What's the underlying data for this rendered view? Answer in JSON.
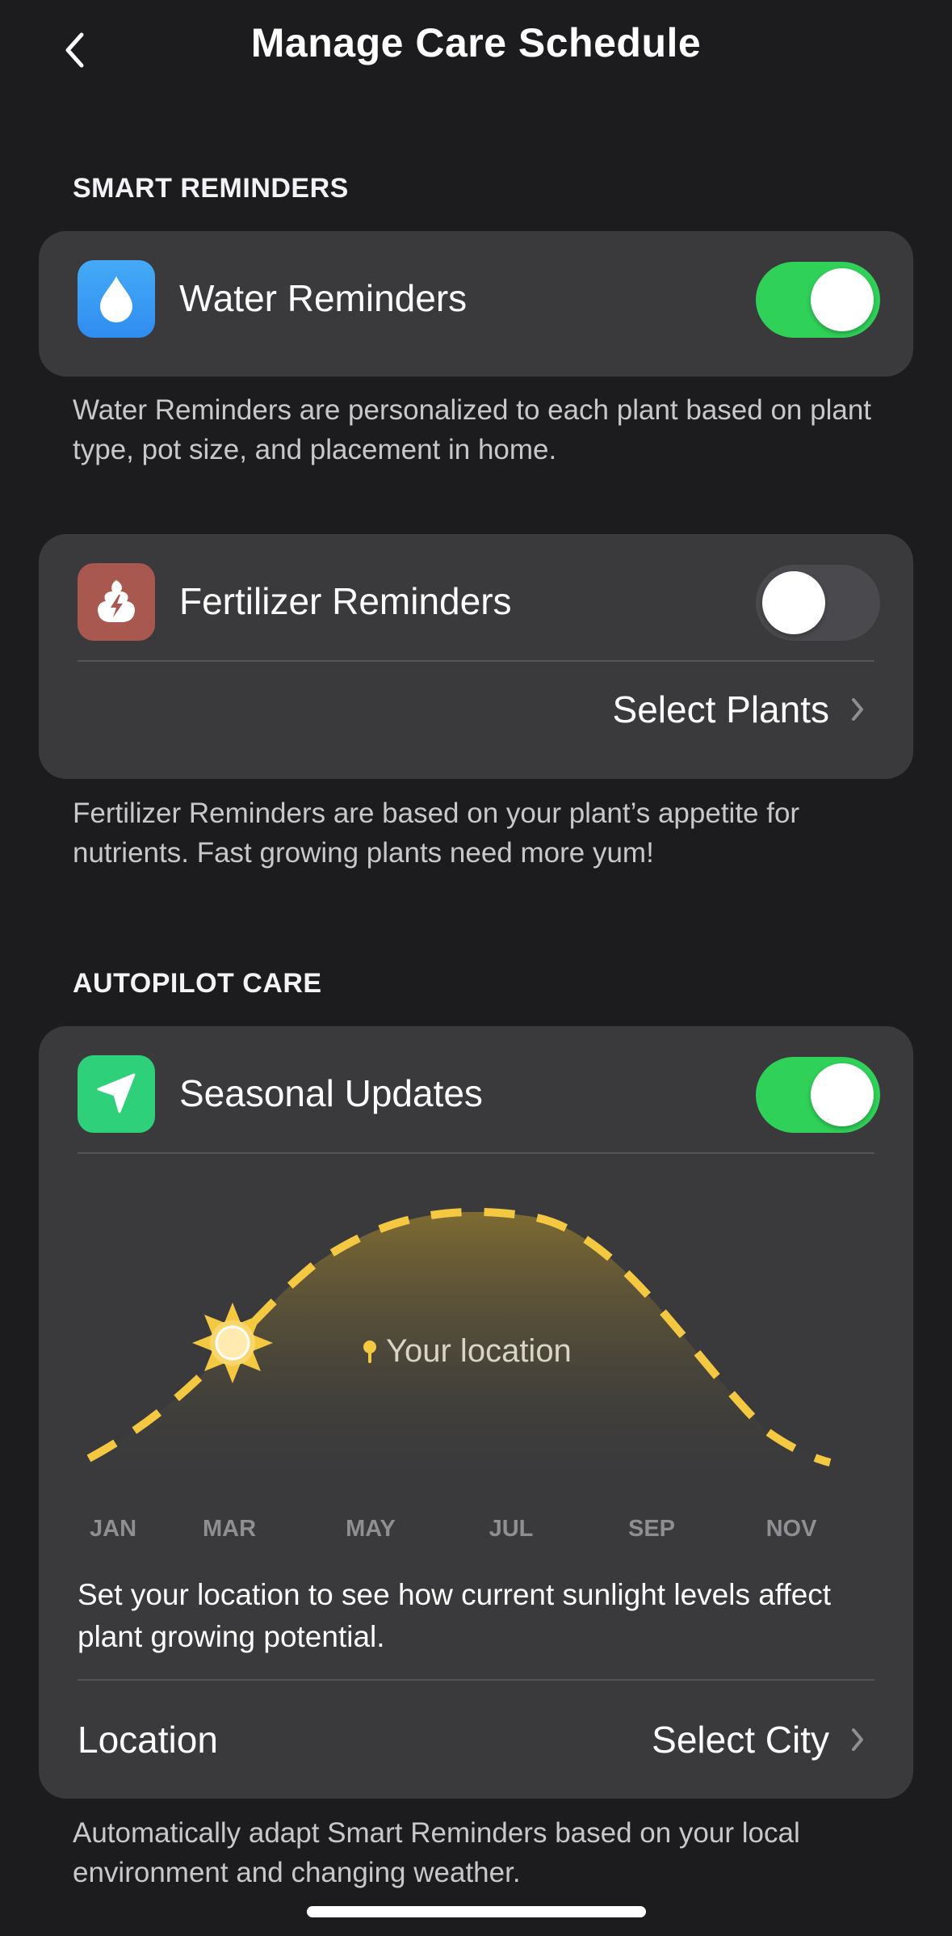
{
  "header": {
    "title": "Manage Care Schedule"
  },
  "smart_reminders": {
    "section_title": "SMART REMINDERS",
    "water": {
      "label": "Water Reminders",
      "enabled": true,
      "description": "Water Reminders are personalized to each plant based on plant type, pot size, and placement in home."
    },
    "fertilizer": {
      "label": "Fertilizer Reminders",
      "enabled": false,
      "select_plants_label": "Select Plants",
      "description": "Fertilizer Reminders are based on your plant’s appetite for nutrients. Fast growing plants need more yum!"
    }
  },
  "autopilot": {
    "section_title": "AUTOPILOT CARE",
    "seasonal": {
      "label": "Seasonal Updates",
      "enabled": true
    },
    "chart": {
      "location_marker_label": "Your location",
      "months": [
        "JAN",
        "MAR",
        "MAY",
        "JUL",
        "SEP",
        "NOV"
      ]
    },
    "prompt_text": "Set your location to see how current sunlight levels affect plant growing potential.",
    "location_label": "Location",
    "location_value": "Select City",
    "description": "Automatically adapt Smart Reminders based on your local environment and changing weather."
  },
  "colors": {
    "background": "#1c1c1e",
    "card": "#3a3a3c",
    "toggle_on": "#30d158",
    "toggle_off": "#4a4a4e",
    "sun_curve": "#f5c842",
    "water_icon": "#3aa0f3",
    "fertilizer_icon": "#a8584f",
    "seasonal_icon": "#2fd07a"
  },
  "icons": {
    "back": "chevron-left-icon",
    "water": "water-drop-icon",
    "fertilizer": "fertilizer-icon",
    "seasonal": "location-arrow-icon",
    "sun": "sun-icon",
    "pin": "location-pin-icon",
    "chevron": "chevron-right-icon"
  }
}
